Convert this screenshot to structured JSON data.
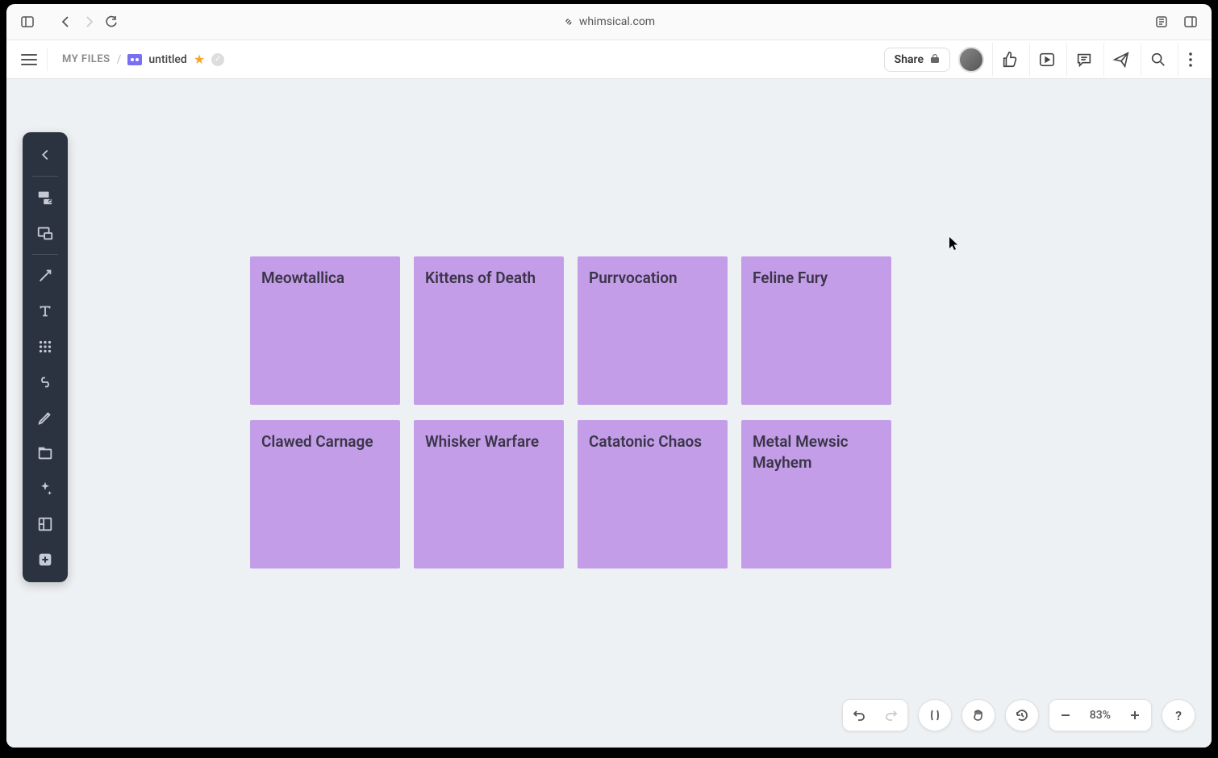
{
  "browser": {
    "url": "whimsical.com"
  },
  "header": {
    "breadcrumb_root": "MY FILES",
    "breadcrumb_sep": "/",
    "doc_title": "untitled",
    "share_label": "Share"
  },
  "cards": [
    {
      "text": "Meowtallica"
    },
    {
      "text": "Kittens of Death"
    },
    {
      "text": "Purrvocation"
    },
    {
      "text": "Feline Fury"
    },
    {
      "text": "Clawed Carnage"
    },
    {
      "text": "Whisker Warfare"
    },
    {
      "text": "Catatonic Chaos"
    },
    {
      "text": "Metal Mewsic Mayhem"
    }
  ],
  "footer": {
    "zoom": "83%"
  },
  "colors": {
    "card_bg": "#c49de8",
    "canvas_bg": "#eef1f3",
    "toolbar_bg": "#2b3240"
  }
}
